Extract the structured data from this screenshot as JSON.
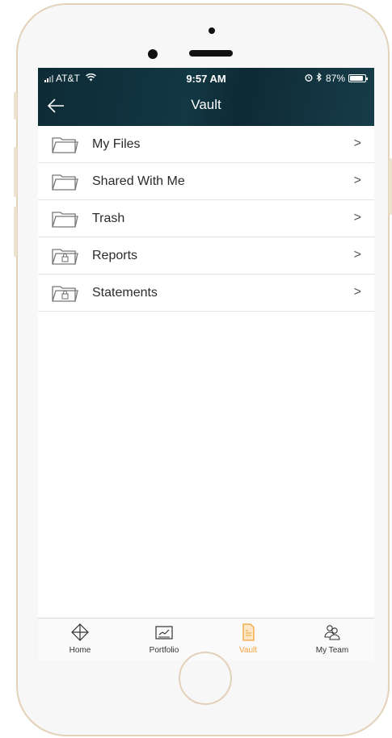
{
  "status_bar": {
    "carrier": "AT&T",
    "time": "9:57 AM",
    "battery": "87%",
    "battery_level": 0.87
  },
  "nav": {
    "title": "Vault",
    "back_icon": "arrow-left-icon"
  },
  "items": [
    {
      "label": "My Files",
      "icon": "folder-icon"
    },
    {
      "label": "Shared With Me",
      "icon": "folder-icon"
    },
    {
      "label": "Trash",
      "icon": "folder-icon"
    },
    {
      "label": "Reports",
      "icon": "locked-folder-icon"
    },
    {
      "label": "Statements",
      "icon": "locked-folder-icon"
    }
  ],
  "chevron": ">",
  "tabs": [
    {
      "label": "Home",
      "icon": "diamond-arrows-icon",
      "active": false
    },
    {
      "label": "Portfolio",
      "icon": "chart-icon",
      "active": false
    },
    {
      "label": "Vault",
      "icon": "document-icon",
      "active": true
    },
    {
      "label": "My Team",
      "icon": "team-icon",
      "active": false
    }
  ],
  "colors": {
    "header": "#0d2b35",
    "accent": "#f2a33a",
    "phone_frame": "#e2d2b8"
  }
}
